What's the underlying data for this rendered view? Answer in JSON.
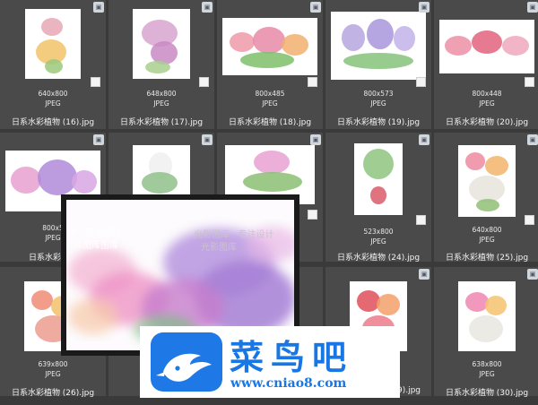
{
  "tiles": [
    {
      "dims": "640x800",
      "type": "JPEG",
      "name": "日系水彩植物 (16).jpg"
    },
    {
      "dims": "648x800",
      "type": "JPEG",
      "name": "日系水彩植物 (17).jpg"
    },
    {
      "dims": "800x485",
      "type": "JPEG",
      "name": "日系水彩植物 (18).jpg"
    },
    {
      "dims": "800x573",
      "type": "JPEG",
      "name": "日系水彩植物 (19).jpg"
    },
    {
      "dims": "800x448",
      "type": "JPEG",
      "name": "日系水彩植物 (20).jpg"
    },
    {
      "dims": "800x5",
      "type": "JPEG",
      "name": "日系水彩植物"
    },
    {
      "dims": "",
      "type": "",
      "name": ""
    },
    {
      "dims": "",
      "type": "",
      "name": ""
    },
    {
      "dims": "523x800",
      "type": "JPEG",
      "name": "日系水彩植物 (24).jpg"
    },
    {
      "dims": "640x800",
      "type": "JPEG",
      "name": "日系水彩植物 (25).jpg"
    },
    {
      "dims": "639x800",
      "type": "JPEG",
      "name": "日系水彩植物 (26).jpg"
    },
    {
      "dims": "",
      "type": "",
      "name": ""
    },
    {
      "dims": "",
      "type": "",
      "name": ""
    },
    {
      "dims": "",
      "type": "",
      "name": "9).jpg"
    },
    {
      "dims": "638x800",
      "type": "JPEG",
      "name": "日系水彩植物 (30).jpg"
    }
  ],
  "preview": {
    "watermark_1": "光影图库 · 专注设计",
    "watermark_2": "光影图库",
    "watermark_3": "中 · 专注设计",
    "watermark_4": "片图库图库"
  },
  "banner": {
    "brand_cn": "菜鸟吧",
    "url": "www.cniao8.com",
    "accent": "#1877e4"
  }
}
